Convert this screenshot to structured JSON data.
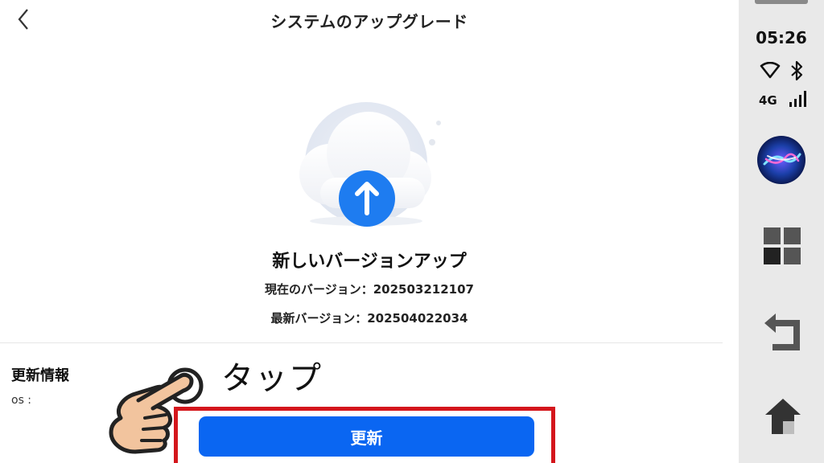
{
  "header": {
    "title": "システムのアップグレード",
    "back_icon": "chevron-left-icon"
  },
  "hero": {
    "icon": "cloud-upload-icon",
    "accent_color": "#1e7cf0"
  },
  "update": {
    "headline": "新しいバージョンアップ",
    "current_version": "現在のバージョン：202503212107",
    "latest_version": "最新バージョン：202504022034"
  },
  "info": {
    "title": "更新情報",
    "os_label": "os :"
  },
  "actions": {
    "update_button": "更新",
    "button_color": "#0a66f2"
  },
  "annotation": {
    "tap_label": "タップ",
    "highlight_color": "#d4161c",
    "pointer_icon": "pointing-hand-icon"
  },
  "system_bar": {
    "time": "05:26",
    "network": "4G",
    "icons": [
      "wifi-icon",
      "bluetooth-icon",
      "signal-icon",
      "assistant-icon",
      "apps-icon",
      "back-icon",
      "home-icon"
    ]
  }
}
